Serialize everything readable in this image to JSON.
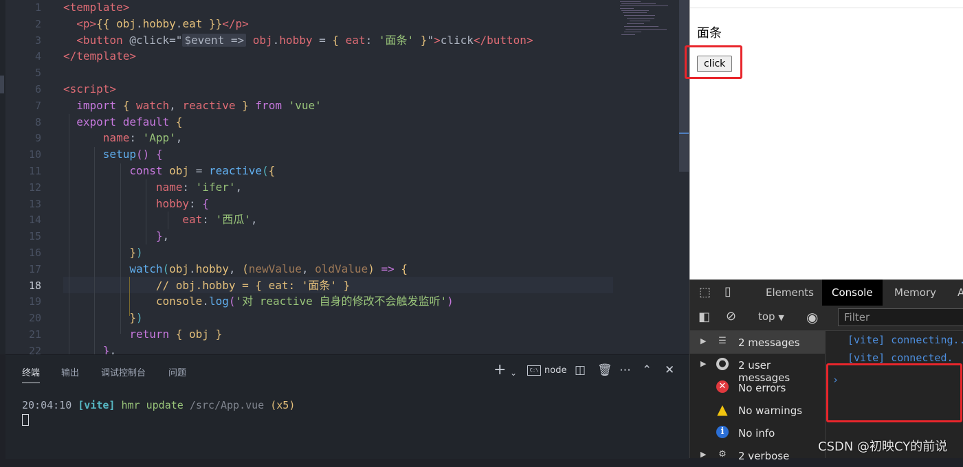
{
  "editor": {
    "lines": [
      {
        "n": "1",
        "html": "<span class='tag'>&lt;template&gt;</span>"
      },
      {
        "n": "2",
        "html": "  <span class='tag'>&lt;p&gt;</span><span class='b1'>{{</span> <span class='var'>obj</span><span class='punc'>.</span><span class='var'>hobby</span><span class='punc'>.</span><span class='var'>eat</span> <span class='b1'>}}</span><span class='tag'>&lt;/p&gt;</span>"
      },
      {
        "n": "3",
        "html": "  <span class='tag'>&lt;button</span> <span class='punc'>@click</span><span class='punc'>=\"</span><span class='hint'><span class='punc'>$event</span> <span class='punc'>=&gt;</span></span> <span class='prop'>obj</span><span class='punc'>.</span><span class='prop'>hobby</span> <span class='punc'>=</span> <span class='b1'>{</span> <span class='prop'>eat</span><span class='punc'>:</span> <span class='str'>'面条'</span> <span class='b1'>}</span><span class='punc'>\"</span><span class='tag'>&gt;</span><span class='punc'>click</span><span class='tag'>&lt;/button&gt;</span>"
      },
      {
        "n": "4",
        "html": "<span class='tag'>&lt;/template&gt;</span>"
      },
      {
        "n": "5",
        "html": ""
      },
      {
        "n": "6",
        "html": "<span class='tag'>&lt;script&gt;</span>"
      },
      {
        "n": "7",
        "html": "  <span class='kw'>import</span> <span class='b1'>{</span> <span class='prop'>watch</span><span class='punc'>,</span> <span class='prop'>reactive</span> <span class='b1'>}</span> <span class='kw'>from</span> <span class='str'>'vue'</span>"
      },
      {
        "n": "8",
        "html": "  <span class='kw'>export</span> <span class='kw'>default</span> <span class='b1'>{</span>"
      },
      {
        "n": "9",
        "html": "      <span class='prop'>name</span><span class='punc'>:</span> <span class='str'>'App'</span><span class='punc'>,</span>"
      },
      {
        "n": "10",
        "html": "      <span class='fn'>setup</span><span class='b2'>()</span> <span class='b2'>{</span>"
      },
      {
        "n": "11",
        "html": "          <span class='kw'>const</span> <span class='var'>obj</span> <span class='punc'>=</span> <span class='fn'>reactive</span><span class='b3'>(</span><span class='b1'>{</span>"
      },
      {
        "n": "12",
        "html": "              <span class='prop'>name</span><span class='punc'>:</span> <span class='str'>'ifer'</span><span class='punc'>,</span>"
      },
      {
        "n": "13",
        "html": "              <span class='prop'>hobby</span><span class='punc'>:</span> <span class='b2'>{</span>"
      },
      {
        "n": "14",
        "html": "                  <span class='prop'>eat</span><span class='punc'>:</span> <span class='str'>'西瓜'</span><span class='punc'>,</span>"
      },
      {
        "n": "15",
        "html": "              <span class='b2'>}</span><span class='punc'>,</span>"
      },
      {
        "n": "16",
        "html": "          <span class='b1'>}</span><span class='b3'>)</span>"
      },
      {
        "n": "17",
        "html": "          <span class='fn'>watch</span><span class='b3'>(</span><span class='var'>obj</span><span class='punc'>.</span><span class='var'>hobby</span><span class='punc'>,</span> <span class='b1'>(</span><span class='param'>newValue</span><span class='punc'>,</span> <span class='param'>oldValue</span><span class='b1'>)</span> <span class='kw'>=&gt;</span> <span class='b1'>{</span>"
      },
      {
        "n": "18",
        "html": "              <span class='cmt'>// obj.hobby = { eat: '面条' }</span>"
      },
      {
        "n": "19",
        "html": "              <span class='var'>console</span><span class='punc'>.</span><span class='fn'>log</span><span class='b2'>(</span><span class='str'>'对 reactive 自身的修改不会触发监听'</span><span class='b2'>)</span>"
      },
      {
        "n": "20",
        "html": "          <span class='b1'>}</span><span class='b3'>)</span>"
      },
      {
        "n": "21",
        "html": "          <span class='kw'>return</span> <span class='b1'>{</span> <span class='var'>obj</span> <span class='b1'>}</span>"
      },
      {
        "n": "22",
        "html": "      <span class='b2'>}</span><span class='punc'>,</span>"
      }
    ],
    "active_line": "18"
  },
  "terminal": {
    "tabs": [
      "终端",
      "输出",
      "调试控制台",
      "问题"
    ],
    "node_label": "node",
    "node_box": "C:\\",
    "log": {
      "time": "20:04:10",
      "tag": "[vite]",
      "action": "hmr update",
      "path": "/src/App.vue",
      "count": "(x5)"
    }
  },
  "page": {
    "text": "面条",
    "button": "click"
  },
  "devtools": {
    "tabs": [
      "Elements",
      "Console",
      "Memory",
      "A"
    ],
    "active_tab": "Console",
    "context": "top",
    "filter_placeholder": "Filter",
    "sidebar": [
      {
        "label": "2 messages",
        "icon": "list",
        "arrow": true
      },
      {
        "label": "2 user messages",
        "icon": "user",
        "arrow": true
      },
      {
        "label": "No errors",
        "icon": "err",
        "arrow": false
      },
      {
        "label": "No warnings",
        "icon": "warn",
        "arrow": false
      },
      {
        "label": "No info",
        "icon": "info",
        "arrow": false
      },
      {
        "label": "2 verbose",
        "icon": "verb",
        "arrow": true
      }
    ],
    "messages": [
      "[vite] connecting...",
      "[vite] connected."
    ],
    "prompt": "›"
  },
  "watermark": "CSDN @初映CY的前说",
  "colors": {
    "highlight": "#e8262c",
    "console_link": "#4d8fe0"
  }
}
